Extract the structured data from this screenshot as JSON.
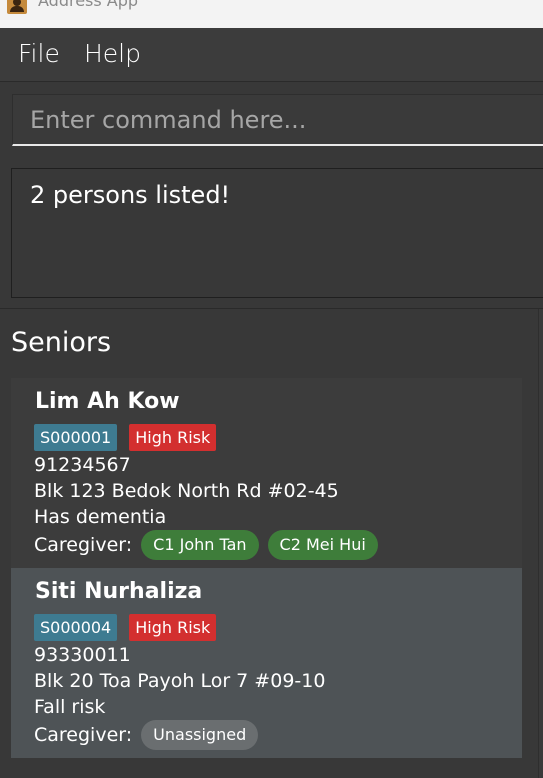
{
  "window": {
    "title": "Address App"
  },
  "menu": {
    "items": [
      "File",
      "Help"
    ]
  },
  "command": {
    "placeholder": "Enter command here..."
  },
  "result": {
    "message": "2 persons listed!"
  },
  "list": {
    "title": "Seniors",
    "persons": [
      {
        "name": "Lim Ah Kow",
        "id": "S000001",
        "risk": "High Risk",
        "phone": "91234567",
        "address": "Blk 123 Bedok North Rd #02-45",
        "note": "Has dementia",
        "caregiver_label": "Caregiver:",
        "caregivers": [
          "C1 John Tan",
          "C2 Mei Hui"
        ]
      },
      {
        "name": "Siti Nurhaliza",
        "id": "S000004",
        "risk": "High Risk",
        "phone": "93330011",
        "address": "Blk 20 Toa Payoh Lor 7 #09-10",
        "note": "Fall risk",
        "caregiver_label": "Caregiver:",
        "caregivers": [
          "Unassigned"
        ]
      }
    ]
  },
  "colors": {
    "id_tag": "#3e7b91",
    "risk_tag": "#d32f2f",
    "caregiver_pill": "#3e7d3a",
    "unassigned_pill": "#6a6e70",
    "selected_card": "#4e5356"
  },
  "icons": {
    "app": "address-book-icon"
  }
}
